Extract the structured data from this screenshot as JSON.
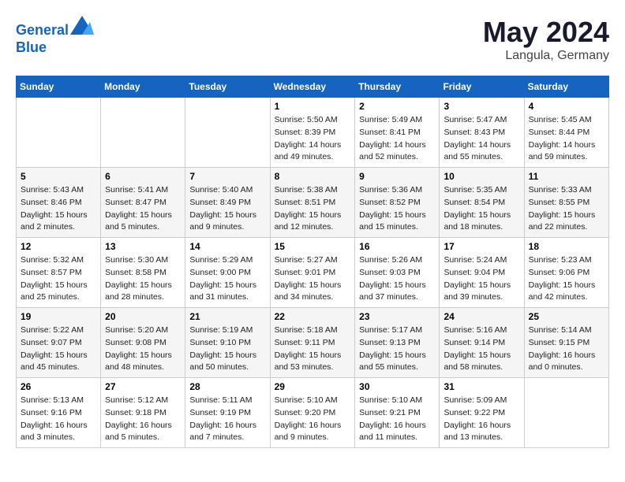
{
  "header": {
    "logo_line1": "General",
    "logo_line2": "Blue",
    "month_title": "May 2024",
    "location": "Langula, Germany"
  },
  "weekdays": [
    "Sunday",
    "Monday",
    "Tuesday",
    "Wednesday",
    "Thursday",
    "Friday",
    "Saturday"
  ],
  "weeks": [
    [
      {
        "day": "",
        "sunrise": "",
        "sunset": "",
        "daylight": ""
      },
      {
        "day": "",
        "sunrise": "",
        "sunset": "",
        "daylight": ""
      },
      {
        "day": "",
        "sunrise": "",
        "sunset": "",
        "daylight": ""
      },
      {
        "day": "1",
        "sunrise": "Sunrise: 5:50 AM",
        "sunset": "Sunset: 8:39 PM",
        "daylight": "Daylight: 14 hours and 49 minutes."
      },
      {
        "day": "2",
        "sunrise": "Sunrise: 5:49 AM",
        "sunset": "Sunset: 8:41 PM",
        "daylight": "Daylight: 14 hours and 52 minutes."
      },
      {
        "day": "3",
        "sunrise": "Sunrise: 5:47 AM",
        "sunset": "Sunset: 8:43 PM",
        "daylight": "Daylight: 14 hours and 55 minutes."
      },
      {
        "day": "4",
        "sunrise": "Sunrise: 5:45 AM",
        "sunset": "Sunset: 8:44 PM",
        "daylight": "Daylight: 14 hours and 59 minutes."
      }
    ],
    [
      {
        "day": "5",
        "sunrise": "Sunrise: 5:43 AM",
        "sunset": "Sunset: 8:46 PM",
        "daylight": "Daylight: 15 hours and 2 minutes."
      },
      {
        "day": "6",
        "sunrise": "Sunrise: 5:41 AM",
        "sunset": "Sunset: 8:47 PM",
        "daylight": "Daylight: 15 hours and 5 minutes."
      },
      {
        "day": "7",
        "sunrise": "Sunrise: 5:40 AM",
        "sunset": "Sunset: 8:49 PM",
        "daylight": "Daylight: 15 hours and 9 minutes."
      },
      {
        "day": "8",
        "sunrise": "Sunrise: 5:38 AM",
        "sunset": "Sunset: 8:51 PM",
        "daylight": "Daylight: 15 hours and 12 minutes."
      },
      {
        "day": "9",
        "sunrise": "Sunrise: 5:36 AM",
        "sunset": "Sunset: 8:52 PM",
        "daylight": "Daylight: 15 hours and 15 minutes."
      },
      {
        "day": "10",
        "sunrise": "Sunrise: 5:35 AM",
        "sunset": "Sunset: 8:54 PM",
        "daylight": "Daylight: 15 hours and 18 minutes."
      },
      {
        "day": "11",
        "sunrise": "Sunrise: 5:33 AM",
        "sunset": "Sunset: 8:55 PM",
        "daylight": "Daylight: 15 hours and 22 minutes."
      }
    ],
    [
      {
        "day": "12",
        "sunrise": "Sunrise: 5:32 AM",
        "sunset": "Sunset: 8:57 PM",
        "daylight": "Daylight: 15 hours and 25 minutes."
      },
      {
        "day": "13",
        "sunrise": "Sunrise: 5:30 AM",
        "sunset": "Sunset: 8:58 PM",
        "daylight": "Daylight: 15 hours and 28 minutes."
      },
      {
        "day": "14",
        "sunrise": "Sunrise: 5:29 AM",
        "sunset": "Sunset: 9:00 PM",
        "daylight": "Daylight: 15 hours and 31 minutes."
      },
      {
        "day": "15",
        "sunrise": "Sunrise: 5:27 AM",
        "sunset": "Sunset: 9:01 PM",
        "daylight": "Daylight: 15 hours and 34 minutes."
      },
      {
        "day": "16",
        "sunrise": "Sunrise: 5:26 AM",
        "sunset": "Sunset: 9:03 PM",
        "daylight": "Daylight: 15 hours and 37 minutes."
      },
      {
        "day": "17",
        "sunrise": "Sunrise: 5:24 AM",
        "sunset": "Sunset: 9:04 PM",
        "daylight": "Daylight: 15 hours and 39 minutes."
      },
      {
        "day": "18",
        "sunrise": "Sunrise: 5:23 AM",
        "sunset": "Sunset: 9:06 PM",
        "daylight": "Daylight: 15 hours and 42 minutes."
      }
    ],
    [
      {
        "day": "19",
        "sunrise": "Sunrise: 5:22 AM",
        "sunset": "Sunset: 9:07 PM",
        "daylight": "Daylight: 15 hours and 45 minutes."
      },
      {
        "day": "20",
        "sunrise": "Sunrise: 5:20 AM",
        "sunset": "Sunset: 9:08 PM",
        "daylight": "Daylight: 15 hours and 48 minutes."
      },
      {
        "day": "21",
        "sunrise": "Sunrise: 5:19 AM",
        "sunset": "Sunset: 9:10 PM",
        "daylight": "Daylight: 15 hours and 50 minutes."
      },
      {
        "day": "22",
        "sunrise": "Sunrise: 5:18 AM",
        "sunset": "Sunset: 9:11 PM",
        "daylight": "Daylight: 15 hours and 53 minutes."
      },
      {
        "day": "23",
        "sunrise": "Sunrise: 5:17 AM",
        "sunset": "Sunset: 9:13 PM",
        "daylight": "Daylight: 15 hours and 55 minutes."
      },
      {
        "day": "24",
        "sunrise": "Sunrise: 5:16 AM",
        "sunset": "Sunset: 9:14 PM",
        "daylight": "Daylight: 15 hours and 58 minutes."
      },
      {
        "day": "25",
        "sunrise": "Sunrise: 5:14 AM",
        "sunset": "Sunset: 9:15 PM",
        "daylight": "Daylight: 16 hours and 0 minutes."
      }
    ],
    [
      {
        "day": "26",
        "sunrise": "Sunrise: 5:13 AM",
        "sunset": "Sunset: 9:16 PM",
        "daylight": "Daylight: 16 hours and 3 minutes."
      },
      {
        "day": "27",
        "sunrise": "Sunrise: 5:12 AM",
        "sunset": "Sunset: 9:18 PM",
        "daylight": "Daylight: 16 hours and 5 minutes."
      },
      {
        "day": "28",
        "sunrise": "Sunrise: 5:11 AM",
        "sunset": "Sunset: 9:19 PM",
        "daylight": "Daylight: 16 hours and 7 minutes."
      },
      {
        "day": "29",
        "sunrise": "Sunrise: 5:10 AM",
        "sunset": "Sunset: 9:20 PM",
        "daylight": "Daylight: 16 hours and 9 minutes."
      },
      {
        "day": "30",
        "sunrise": "Sunrise: 5:10 AM",
        "sunset": "Sunset: 9:21 PM",
        "daylight": "Daylight: 16 hours and 11 minutes."
      },
      {
        "day": "31",
        "sunrise": "Sunrise: 5:09 AM",
        "sunset": "Sunset: 9:22 PM",
        "daylight": "Daylight: 16 hours and 13 minutes."
      },
      {
        "day": "",
        "sunrise": "",
        "sunset": "",
        "daylight": ""
      }
    ]
  ]
}
